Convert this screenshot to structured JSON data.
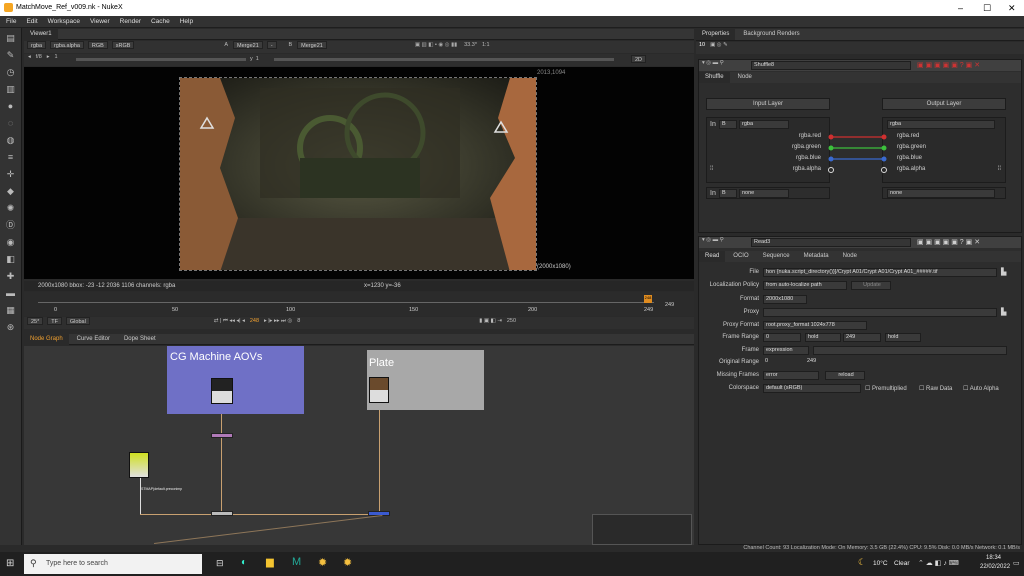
{
  "window": {
    "title": "MatchMove_Ref_v009.nk - NukeX",
    "min": "–",
    "max": "☐",
    "close": "✕"
  },
  "menu": [
    "File",
    "Edit",
    "Workspace",
    "Viewer",
    "Render",
    "Cache",
    "Help"
  ],
  "viewer": {
    "tab": "Viewer1",
    "channels": "rgba",
    "alpha": "rgba.alpha",
    "rgb": "RGB",
    "colorspace": "sRGB",
    "a_label": "A",
    "a_input": "Merge21",
    "dash": "-",
    "b_label": "B",
    "b_input": "Merge21",
    "zoom": "33.3*",
    "ratio": "1:1",
    "fstop": "f/8",
    "fstop_arrow": "▸",
    "one": "1",
    "y_label": "y",
    "y_value": "1",
    "view": "2D",
    "top_right_coord": "2013,1094",
    "format_label": "(2000x1080)",
    "info_left": "2000x1080  bbox: -23 -12 2036 1106 channels: rgba",
    "info_center": "x=1230 y=-36",
    "timeline_ticks": [
      "0",
      "50",
      "100",
      "150",
      "200",
      "249"
    ],
    "timeline_end": "249",
    "current_frame_marker": "248",
    "fps": "25*",
    "tf": "TF",
    "global": "Global",
    "frame": "248",
    "increment": "8",
    "end_frame": "250"
  },
  "properties": {
    "tab1": "Properties",
    "tab2": "Background Renders",
    "max_panels": "10",
    "shuffle": {
      "name": "Shuffle8",
      "tab_shuffle": "Shuffle",
      "tab_node": "Node",
      "input_layer": "Input Layer",
      "output_layer": "Output Layer",
      "in_label": "In",
      "in_b": "B",
      "in_layer": "rgba",
      "out_layer": "rgba",
      "channels_in": [
        "rgba.red",
        "rgba.green",
        "rgba.blue",
        "rgba.alpha"
      ],
      "channels_out": [
        "rgba.red",
        "rgba.green",
        "rgba.blue",
        "rgba.alpha"
      ],
      "in2_label": "In",
      "in2_b": "B",
      "in2_layer": "none",
      "out2_layer": "none",
      "colors": {
        "red": "#d03030",
        "green": "#3cc03c",
        "blue": "#3a6ad0"
      }
    },
    "read": {
      "name": "Read3",
      "tabs": [
        "Read",
        "OCIO",
        "Sequence",
        "Metadata",
        "Node"
      ],
      "file_label": "File",
      "file": "hon {nuka.script_directory()}]/Crypt A01/Crypt A01/Crypt A01_#####.tif",
      "loc_label": "Localization Policy",
      "loc": "from auto-localize path",
      "update": "Update",
      "format_label": "Format",
      "format": "2000x1080",
      "proxy_label": "Proxy",
      "proxy": "",
      "proxy_format_label": "Proxy Format",
      "proxy_format": "root.proxy_format 1024x778",
      "frame_range_label": "Frame Range",
      "fr_start": "0",
      "fr_start_mode": "hold",
      "fr_end": "249",
      "fr_end_mode": "hold",
      "frame_label": "Frame",
      "frame_mode": "expression",
      "orig_range_label": "Original Range",
      "orig_start": "0",
      "orig_end": "249",
      "missing_label": "Missing Frames",
      "missing": "error",
      "reload": "reload",
      "colorspace_label": "Colorspace",
      "colorspace": "default (sRGB)",
      "premult": "Premultiplied",
      "rawdata": "Raw Data",
      "autoalpha": "Auto Alpha"
    }
  },
  "nodegraph": {
    "tabs": [
      "Node Graph",
      "Curve Editor",
      "Dope Sheet"
    ],
    "backdrop1": "CG Machine AOVs",
    "backdrop2": "Plate",
    "small_label": "STMAP(default.preconimp"
  },
  "statusbar": "Channel Count: 93  Localization Mode: On  Memory: 3.5 GB (22.4%)  CPU: 9.5%  Disk: 0.0 MB/s  Network: 0.1 MB/s",
  "taskbar": {
    "search": "Type here to search",
    "weather_temp": "10°C",
    "weather": "Clear",
    "time": "18:34",
    "date": "22/02/2022"
  }
}
